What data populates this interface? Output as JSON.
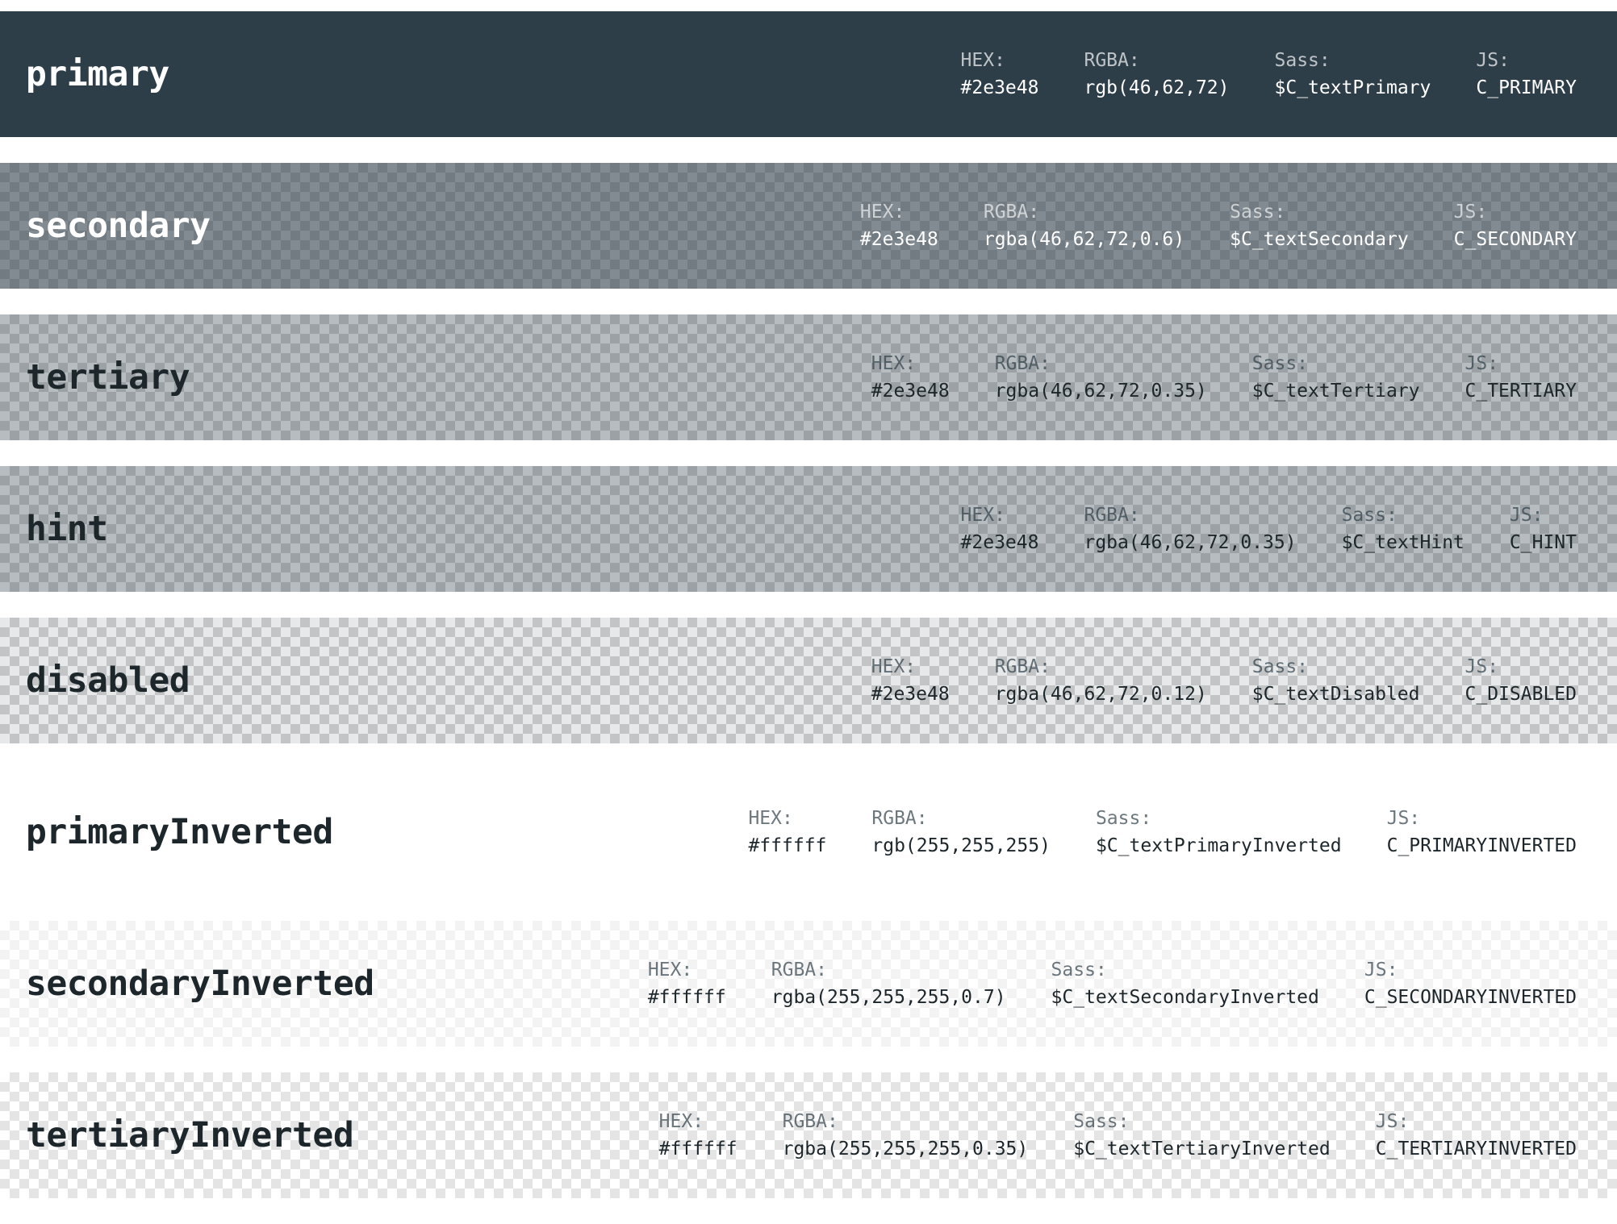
{
  "labels": {
    "hex": "HEX:",
    "rgba": "RGBA:",
    "sass": "Sass:",
    "js": "JS:"
  },
  "swatches": [
    {
      "name": "primary",
      "hex": "#2e3e48",
      "rgba": "rgb(46,62,72)",
      "sass": "$C_textPrimary",
      "js": "C_PRIMARY",
      "fill": "rgba(46,62,72,1)",
      "checker": false,
      "theme": "light"
    },
    {
      "name": "secondary",
      "hex": "#2e3e48",
      "rgba": "rgba(46,62,72,0.6)",
      "sass": "$C_textSecondary",
      "js": "C_SECONDARY",
      "fill": "rgba(46,62,72,0.6)",
      "checker": true,
      "theme": "light"
    },
    {
      "name": "tertiary",
      "hex": "#2e3e48",
      "rgba": "rgba(46,62,72,0.35)",
      "sass": "$C_textTertiary",
      "js": "C_TERTIARY",
      "fill": "rgba(46,62,72,0.35)",
      "checker": true,
      "theme": "dark"
    },
    {
      "name": "hint",
      "hex": "#2e3e48",
      "rgba": "rgba(46,62,72,0.35)",
      "sass": "$C_textHint",
      "js": "C_HINT",
      "fill": "rgba(46,62,72,0.35)",
      "checker": true,
      "theme": "dark"
    },
    {
      "name": "disabled",
      "hex": "#2e3e48",
      "rgba": "rgba(46,62,72,0.12)",
      "sass": "$C_textDisabled",
      "js": "C_DISABLED",
      "fill": "rgba(46,62,72,0.12)",
      "checker": true,
      "theme": "dark"
    },
    {
      "name": "primaryInverted",
      "hex": "#ffffff",
      "rgba": "rgb(255,255,255)",
      "sass": "$C_textPrimaryInverted",
      "js": "C_PRIMARYINVERTED",
      "fill": "rgba(255,255,255,1)",
      "checker": false,
      "theme": "dark"
    },
    {
      "name": "secondaryInverted",
      "hex": "#ffffff",
      "rgba": "rgba(255,255,255,0.7)",
      "sass": "$C_textSecondaryInverted",
      "js": "C_SECONDARYINVERTED",
      "fill": "rgba(255,255,255,0.7)",
      "checker": true,
      "theme": "dark"
    },
    {
      "name": "tertiaryInverted",
      "hex": "#ffffff",
      "rgba": "rgba(255,255,255,0.35)",
      "sass": "$C_textTertiaryInverted",
      "js": "C_TERTIARYINVERTED",
      "fill": "rgba(255,255,255,0.35)",
      "checker": true,
      "theme": "dark"
    }
  ]
}
